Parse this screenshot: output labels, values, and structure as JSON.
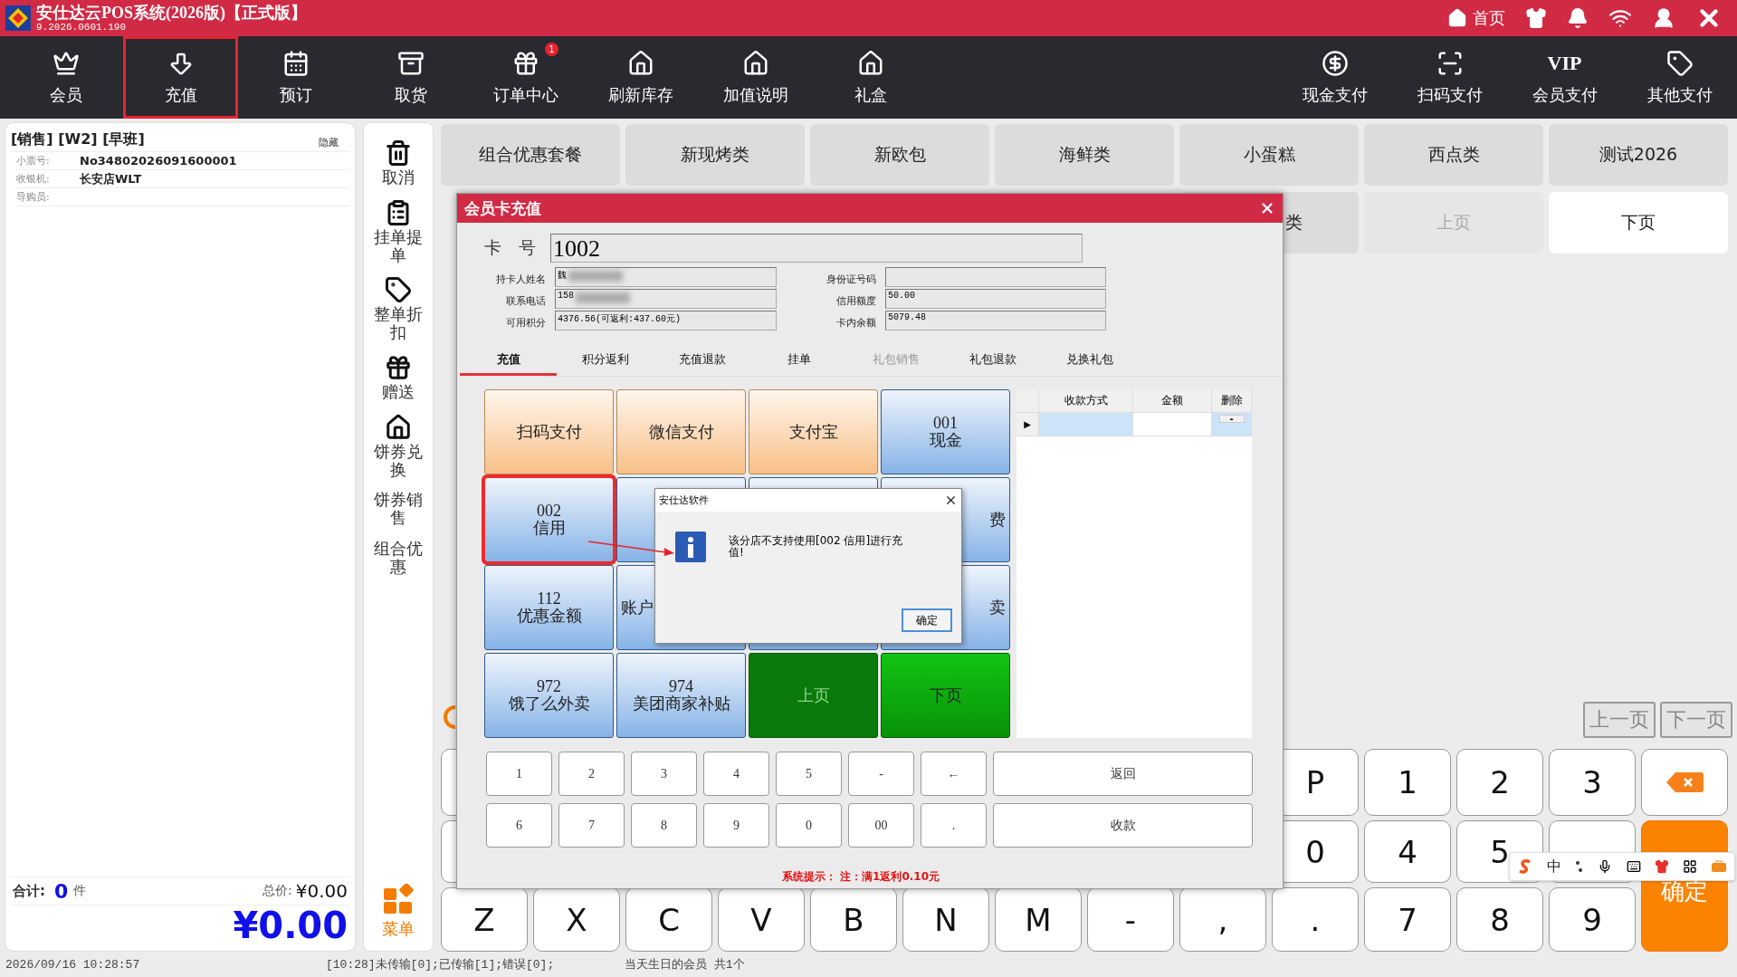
{
  "window": {
    "title": "安仕达云POS系统(2026版)【正式版】",
    "version": "9.2026.0601.190",
    "home_label": "首页"
  },
  "toolbar": {
    "left": [
      {
        "label": "会员",
        "highlighted": false
      },
      {
        "label": "充值",
        "highlighted": true
      },
      {
        "label": "预订",
        "highlighted": false
      },
      {
        "label": "取货",
        "highlighted": false
      },
      {
        "label": "订单中心",
        "highlighted": false,
        "badge": "1"
      },
      {
        "label": "刷新库存",
        "highlighted": false
      },
      {
        "label": "加值说明",
        "highlighted": false
      },
      {
        "label": "礼盒",
        "highlighted": false
      }
    ],
    "right": [
      {
        "label": "现金支付"
      },
      {
        "label": "扫码支付"
      },
      {
        "label": "会员支付",
        "icon_text": "VIP"
      },
      {
        "label": "其他支付"
      }
    ]
  },
  "order_panel": {
    "header": "[销售] [W2] [早班]",
    "hide_label": "隐藏",
    "fields": [
      {
        "label": "小票号:",
        "value": "No34802026091600001"
      },
      {
        "label": "收银机:",
        "value": "长安店WLT"
      },
      {
        "label": "导购员:"
      }
    ],
    "count_label": "合计:",
    "count": "0",
    "count_unit": "件",
    "total_label": "总价:",
    "total": "¥0.00",
    "grand_total": "¥0.00"
  },
  "side_actions": [
    {
      "label": "取消"
    },
    {
      "label": "挂单提单"
    },
    {
      "label": "整单折扣"
    },
    {
      "label": "赠送"
    },
    {
      "label": "饼券兑换"
    },
    {
      "label": "饼券销售"
    },
    {
      "label": "组合优惠"
    }
  ],
  "menu_label": "菜单",
  "categories": [
    {
      "label": "组合优惠套餐",
      "kind": "normal"
    },
    {
      "label": "新现烤类",
      "kind": "normal"
    },
    {
      "label": "新欧包",
      "kind": "normal"
    },
    {
      "label": "海鲜类",
      "kind": "normal"
    },
    {
      "label": "小蛋糕",
      "kind": "normal"
    },
    {
      "label": "西点类",
      "kind": "normal"
    },
    {
      "label": "测试2026",
      "kind": "normal"
    },
    {
      "label": "类",
      "kind": "cut"
    },
    {
      "label": "上页",
      "kind": "disabled"
    },
    {
      "label": "下页",
      "kind": "light"
    }
  ],
  "pager": [
    "上一页",
    "下一页"
  ],
  "keyboard": [
    [
      {
        "kind": "edge"
      },
      {
        "label": "P",
        "kind": "key"
      },
      {
        "label": "1",
        "kind": "key"
      },
      {
        "label": "2",
        "kind": "key"
      },
      {
        "label": "3",
        "kind": "key"
      },
      {
        "kind": "backspace"
      }
    ],
    [
      {
        "kind": "edge"
      },
      {
        "label": "0",
        "kind": "key"
      },
      {
        "label": "4",
        "kind": "key"
      },
      {
        "label": "5",
        "kind": "key"
      },
      {
        "kind": "key"
      },
      {
        "label": "确定",
        "kind": "enter"
      }
    ],
    [
      {
        "label": "Z",
        "kind": "key"
      },
      {
        "label": "X",
        "kind": "key"
      },
      {
        "label": "C",
        "kind": "key"
      },
      {
        "label": "V",
        "kind": "key"
      },
      {
        "label": "B",
        "kind": "key"
      },
      {
        "label": "N",
        "kind": "key"
      },
      {
        "label": "M",
        "kind": "key"
      },
      {
        "label": "-",
        "kind": "key"
      },
      {
        "label": ",",
        "kind": "key"
      },
      {
        "label": ".",
        "kind": "key"
      },
      {
        "label": "7",
        "kind": "key"
      },
      {
        "label": "8",
        "kind": "key"
      },
      {
        "label": "9",
        "kind": "key"
      }
    ]
  ],
  "dialog": {
    "title": "会员卡充值",
    "card_label": "卡　号",
    "card_no": "1002",
    "fields": [
      {
        "label": "持卡人姓名",
        "value": "魏",
        "redacted": true
      },
      {
        "label": "身份证号码",
        "redacted": false
      },
      {
        "label": "联系电话",
        "value": "158",
        "redacted": true
      },
      {
        "label": "信用额度",
        "value": "50.00",
        "redacted": false
      },
      {
        "label": "可用积分",
        "value": "4376.56(可返利:437.60元)",
        "redacted": false
      },
      {
        "label": "卡内余额",
        "value": "5079.48",
        "redacted": false
      }
    ],
    "tabs": [
      {
        "label": "充值",
        "selected": true,
        "disabled": false
      },
      {
        "label": "积分返利",
        "selected": false,
        "disabled": false
      },
      {
        "label": "充值退款",
        "selected": false,
        "disabled": false
      },
      {
        "label": "挂单",
        "selected": false,
        "disabled": false
      },
      {
        "label": "礼包销售",
        "selected": false,
        "disabled": true
      },
      {
        "label": "礼包退款",
        "selected": false,
        "disabled": false
      },
      {
        "label": "兑换礼包",
        "selected": false,
        "disabled": false
      }
    ],
    "tenders": [
      {
        "name": "扫码支付",
        "kind": "online",
        "highlighted": false
      },
      {
        "name": "微信支付",
        "kind": "online",
        "highlighted": false
      },
      {
        "name": "支付宝",
        "kind": "online",
        "highlighted": false
      },
      {
        "code": "001",
        "name": "现金",
        "kind": "card",
        "highlighted": false
      },
      {
        "code": "002",
        "name": "信用",
        "kind": "card",
        "highlighted": true
      },
      {
        "kind": "card",
        "highlighted": false
      },
      {
        "kind": "card",
        "highlighted": false
      },
      {
        "name": "费",
        "kind": "card-right",
        "highlighted": false
      },
      {
        "code": "112",
        "name": "优惠金额",
        "kind": "card",
        "highlighted": false
      },
      {
        "name": "账户",
        "kind": "card-left",
        "highlighted": false
      },
      {
        "kind": "card",
        "highlighted": false
      },
      {
        "name": "卖",
        "kind": "card-right",
        "highlighted": false
      },
      {
        "code": "972",
        "name": "饿了么外卖",
        "kind": "card",
        "highlighted": false
      },
      {
        "code": "974",
        "name": "美团商家补贴",
        "kind": "card",
        "highlighted": false
      },
      {
        "name": "上页",
        "kind": "page-disabled",
        "highlighted": false
      },
      {
        "name": "下页",
        "kind": "page",
        "highlighted": false
      }
    ],
    "payments_table": {
      "columns": [
        "收款方式",
        "金额",
        "删除"
      ],
      "rows": [
        {
          "marker": "▶",
          "delete_button": "-"
        }
      ]
    },
    "numpad": [
      [
        {
          "label": "1",
          "kind": "key"
        },
        {
          "label": "2",
          "kind": "key"
        },
        {
          "label": "3",
          "kind": "key"
        },
        {
          "label": "4",
          "kind": "key"
        },
        {
          "label": "5",
          "kind": "key"
        },
        {
          "label": "-",
          "kind": "key"
        },
        {
          "label": "←",
          "kind": "key"
        },
        {
          "label": "返回",
          "kind": "wide"
        }
      ],
      [
        {
          "label": "6",
          "kind": "key"
        },
        {
          "label": "7",
          "kind": "key"
        },
        {
          "label": "8",
          "kind": "key"
        },
        {
          "label": "9",
          "kind": "key"
        },
        {
          "label": "0",
          "kind": "key"
        },
        {
          "label": "00",
          "kind": "key"
        },
        {
          "label": ".",
          "kind": "key"
        },
        {
          "label": "收款",
          "kind": "wide"
        }
      ]
    ],
    "hint": "系统提示： 注：满1返利0.10元"
  },
  "message_box": {
    "title": "安仕达软件",
    "text": "该分店不支持使用[002 信用]进行充值!",
    "button": "确定"
  },
  "ime_bar": {
    "mode": "中"
  },
  "status_bar": {
    "datetime": "2026/09/16 10:28:57",
    "transfer": "[10:28]未传输[0];已传输[1];错误[0];",
    "birthdays": "当天生日的会员 共1个"
  }
}
